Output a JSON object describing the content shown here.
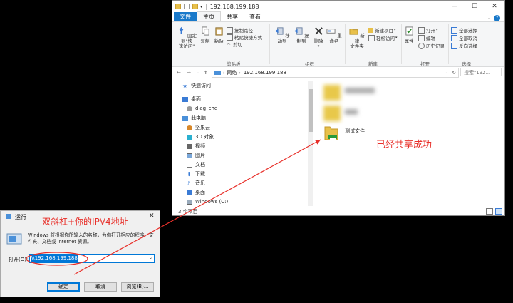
{
  "explorer": {
    "title": "192.168.199.188",
    "window_buttons": [
      "—",
      "☐",
      "✕"
    ],
    "help_icon": "?",
    "tabs": [
      "文件",
      "主页",
      "共享",
      "查看"
    ],
    "ribbon": {
      "pin": "固定到\"快\n速访问\"",
      "copy": "复制",
      "paste": "粘贴",
      "copy_path": "复制路径",
      "paste_shortcut": "粘贴快捷方式",
      "cut": "剪切",
      "group_clipboard": "剪贴板",
      "move_to": "移动到",
      "copy_to": "复制到",
      "delete": "删除",
      "rename": "重命名",
      "group_organize": "组织",
      "new_folder": "新建\n文件夹",
      "new_item": "新建项目",
      "easy_access": "轻松访问",
      "group_new": "新建",
      "properties": "属性",
      "open": "打开",
      "edit": "编辑",
      "history": "历史记录",
      "group_open": "打开",
      "select_all": "全部选择",
      "select_none": "全部取消",
      "invert_selection": "反向选择",
      "group_select": "选择"
    },
    "address": {
      "crumbs": [
        "网络",
        "192.168.199.188"
      ],
      "search_placeholder": "搜索\"192..."
    },
    "nav": [
      "快速访问",
      "桌面",
      "diag_che",
      "此电脑",
      "坚果云",
      "3D 对象",
      "视频",
      "图片",
      "文档",
      "下载",
      "音乐",
      "桌面",
      "Windows (C:)"
    ],
    "files": [
      "测试文件"
    ],
    "status": "3 个项目",
    "annotation_success": "已经共享成功"
  },
  "run": {
    "title": "运行",
    "description": "Windows 将根据你所输入的名称，为你打开相应的程序、文件夹、文档或 Internet 资源。",
    "open_label": "打开(O):",
    "input_value": "\\\\192.168.199.188",
    "ok": "确定",
    "cancel": "取消",
    "browse": "浏览(B)...",
    "close": "✕",
    "annotation_hint": "双斜杠+你的IPV4地址"
  },
  "colors": {
    "annotation": "#e8302a",
    "file_tab": "#1979ca",
    "selection": "#0078d7"
  }
}
